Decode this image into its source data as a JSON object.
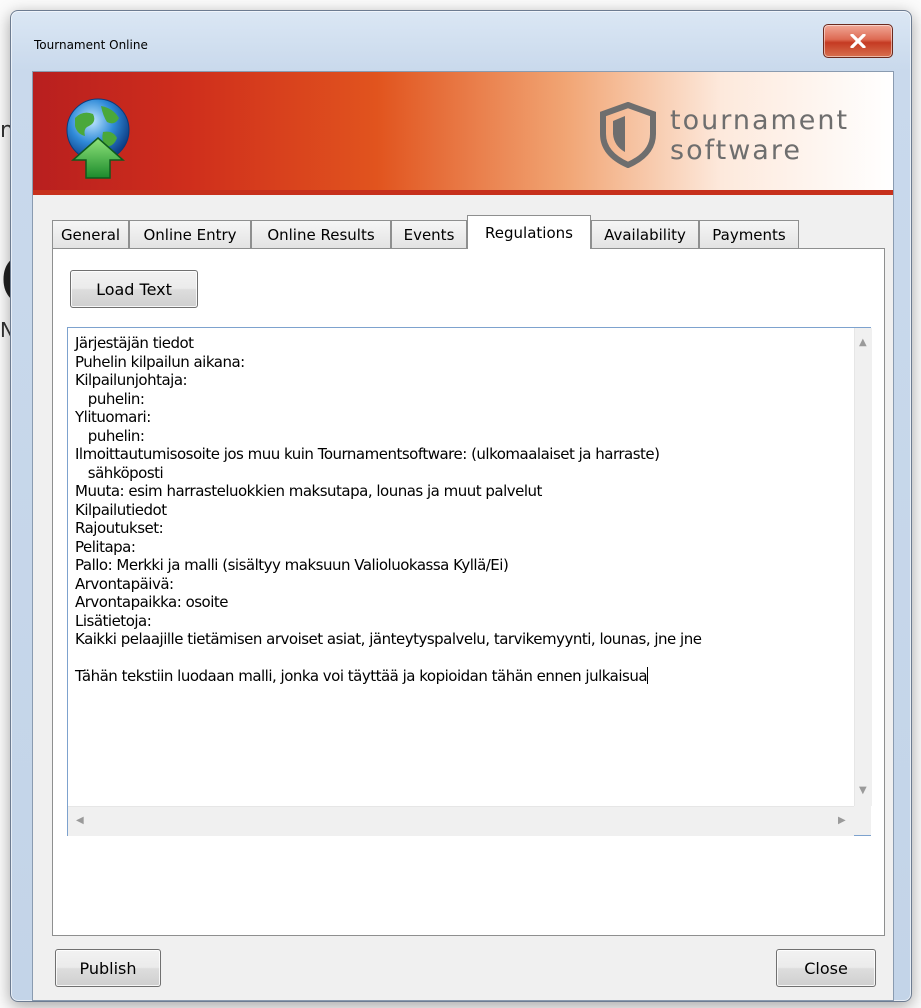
{
  "window": {
    "title": "Tournament Online"
  },
  "background_fragments": {
    "a": "n",
    "b": "C",
    "c": "N"
  },
  "banner": {
    "logo_line1": "tournament",
    "logo_line2": "software"
  },
  "tabs": [
    {
      "label": "General"
    },
    {
      "label": "Online Entry"
    },
    {
      "label": "Online Results"
    },
    {
      "label": "Events"
    },
    {
      "label": "Regulations",
      "active": true
    },
    {
      "label": "Availability"
    },
    {
      "label": "Payments"
    }
  ],
  "regulations": {
    "load_text_label": "Load Text",
    "text_lines": [
      "Järjestäjän tiedot",
      "Puhelin kilpailun aikana:",
      "Kilpailunjohtaja:",
      "   puhelin:",
      "Ylituomari:",
      "   puhelin:",
      "Ilmoittautumisosoite jos muu kuin Tournamentsoftware: (ulkomaalaiset ja harraste)",
      "   sähköposti",
      "Muuta: esim harrasteluokkien maksutapa, lounas ja muut palvelut",
      "Kilpailutiedot",
      "Rajoutukset:",
      "Pelitapa:",
      "Pallo: Merkki ja malli (sisältyy maksuun Valioluokassa Kyllä/Ei)",
      "Arvontapäivä:",
      "Arvontapaikka: osoite",
      "Lisätietoja:",
      "Kaikki pelaajille tietämisen arvoiset asiat, jänteytyspalvelu, tarvikemyynti, lounas, jne jne",
      "",
      "Tähän tekstiin luodaan malli, jonka voi täyttää ja kopioidan tähän ennen julkaisua"
    ]
  },
  "footer": {
    "publish_label": "Publish",
    "close_label": "Close"
  },
  "colors": {
    "banner_red": "#c7301c",
    "focus_border": "#7da2ce"
  }
}
